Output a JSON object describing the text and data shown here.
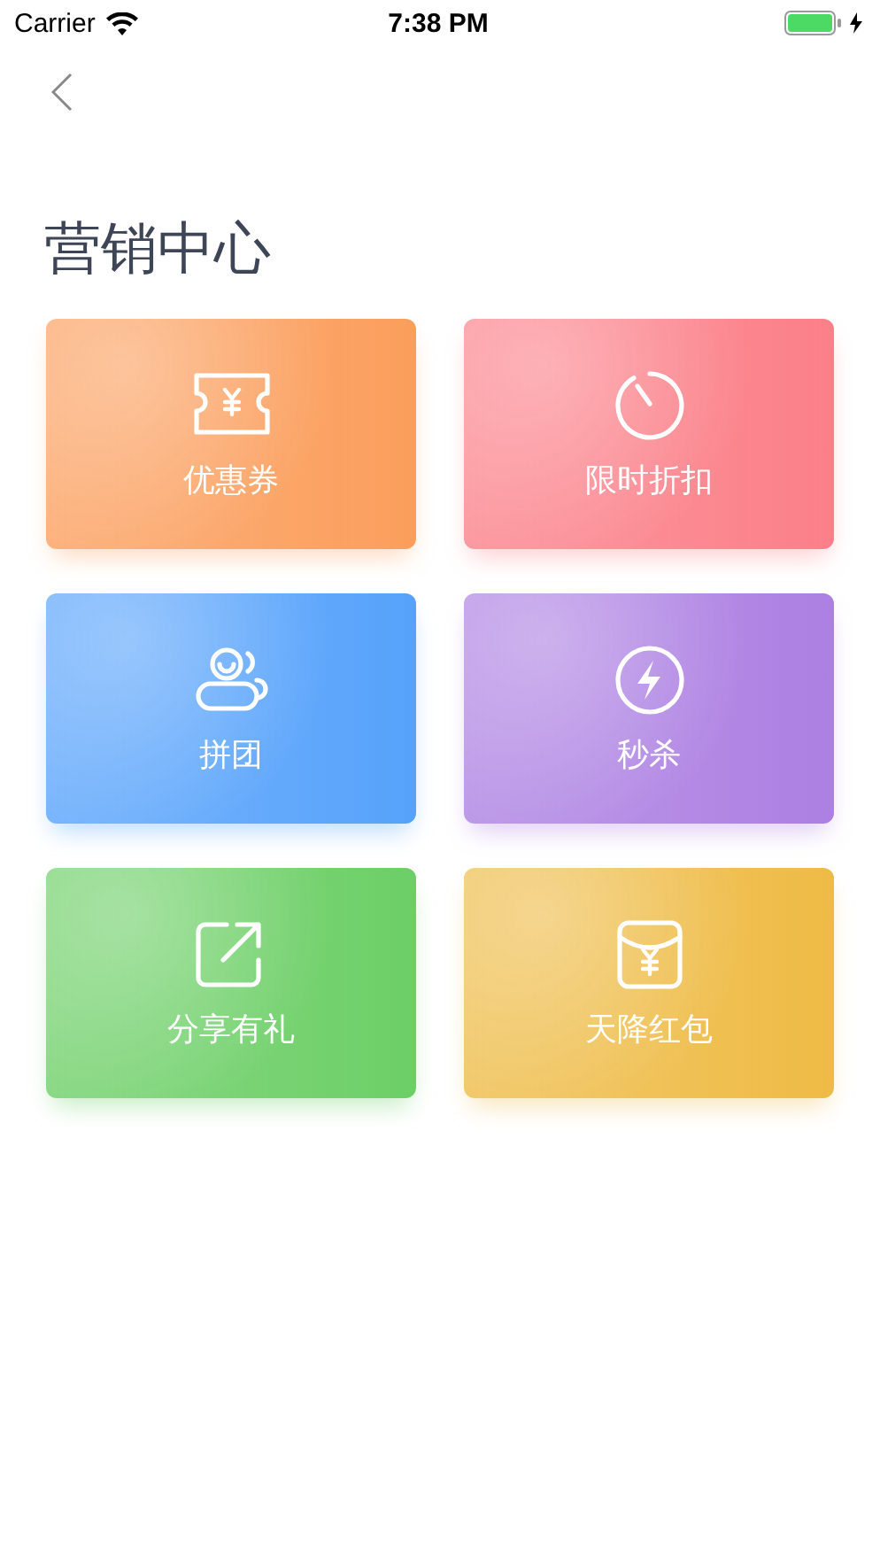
{
  "status_bar": {
    "carrier": "Carrier",
    "time": "7:38 PM"
  },
  "title": "营销中心",
  "cards": [
    {
      "label": "优惠券",
      "kind": "coupon",
      "color": "#fb9e5c"
    },
    {
      "label": "限时折扣",
      "kind": "timer",
      "color": "#fb7f88"
    },
    {
      "label": "拼团",
      "kind": "group",
      "color": "#56a2fb"
    },
    {
      "label": "秒杀",
      "kind": "flash",
      "color": "#ac7fe2"
    },
    {
      "label": "分享有礼",
      "kind": "share",
      "color": "#6ccf66"
    },
    {
      "label": "天降红包",
      "kind": "envelope",
      "color": "#eebb45"
    }
  ]
}
